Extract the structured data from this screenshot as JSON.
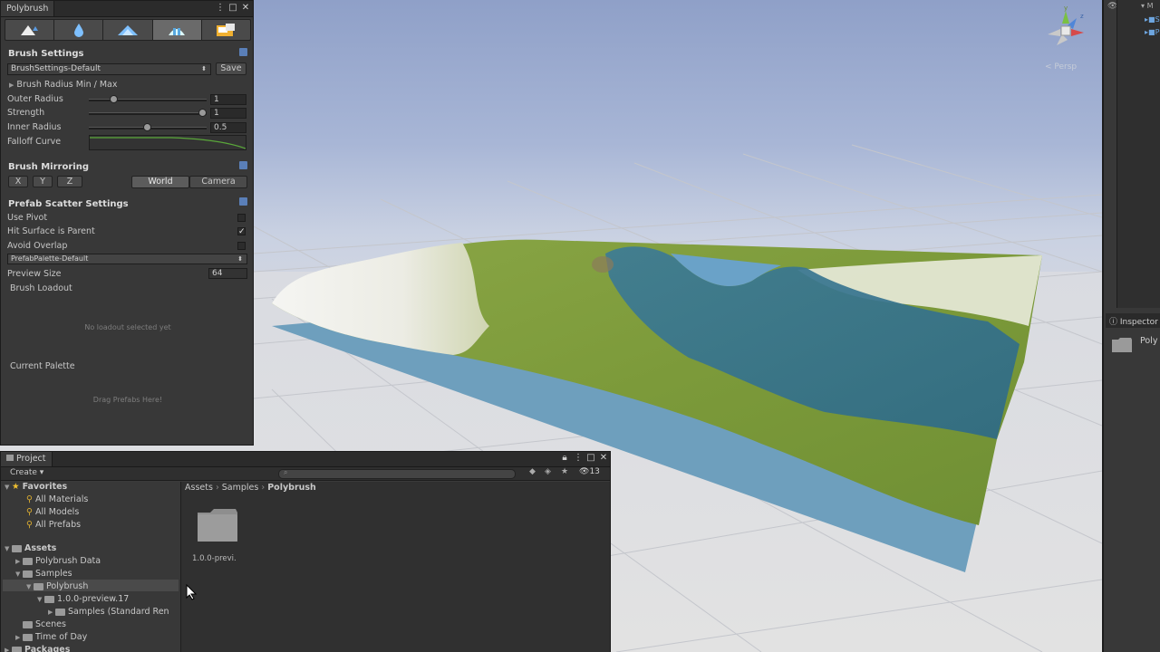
{
  "polybrush": {
    "title": "Polybrush",
    "modes": [
      "raise-lower-icon",
      "smooth-icon",
      "sculpt-icon",
      "scatter-prefab-icon",
      "texture-paint-icon"
    ],
    "brush_settings": {
      "header": "Brush Settings",
      "preset": "BrushSettings-Default",
      "save_label": "Save",
      "radius_foldout": "Brush Radius Min / Max",
      "outer_radius": {
        "label": "Outer Radius",
        "value": "1",
        "level": 0.2
      },
      "strength": {
        "label": "Strength",
        "value": "1",
        "level": 1.0
      },
      "inner_radius": {
        "label": "Inner Radius",
        "value": "0.5",
        "level": 0.5
      },
      "falloff_label": "Falloff Curve"
    },
    "mirroring": {
      "header": "Brush Mirroring",
      "axes": [
        "X",
        "Y",
        "Z"
      ],
      "space_world": "World",
      "space_camera": "Camera"
    },
    "scatter": {
      "header": "Prefab Scatter Settings",
      "use_pivot": {
        "label": "Use Pivot",
        "checked": false
      },
      "hit_surface": {
        "label": "Hit Surface is Parent",
        "checked": true
      },
      "avoid_overlap": {
        "label": "Avoid Overlap",
        "checked": false
      },
      "palette": "PrefabPalette-Default",
      "preview_size_label": "Preview Size",
      "preview_size_value": "64",
      "loadout_label": "Brush Loadout",
      "loadout_empty": "No loadout selected yet",
      "current_palette_label": "Current Palette",
      "drag_hint": "Drag Prefabs Here!"
    }
  },
  "project": {
    "tab": "Project",
    "create_label": "Create",
    "count": "13",
    "breadcrumb": [
      "Assets",
      "Samples",
      "Polybrush"
    ],
    "favorites": {
      "header": "Favorites",
      "items": [
        "All Materials",
        "All Models",
        "All Prefabs"
      ]
    },
    "assets_header": "Assets",
    "tree": {
      "polybrush_data": "Polybrush Data",
      "samples": "Samples",
      "polybrush": "Polybrush",
      "preview": "1.0.0-preview.17",
      "samples_standard": "Samples (Standard Ren",
      "scenes": "Scenes",
      "time_of_day": "Time of Day"
    },
    "packages_header": "Packages",
    "grid_item": "1.0.0-previ."
  },
  "scene": {
    "persp_label": "< Persp",
    "gizmo": {
      "y": "y",
      "z": "z"
    }
  },
  "inspector": {
    "tab": "Inspector",
    "item": "Poly"
  },
  "hierarchy": {
    "rows": [
      "M",
      "S",
      "P"
    ]
  },
  "colors": {
    "accent_blue": "#5a7fb8",
    "water": "#4f86a8",
    "grass": "#7d9a3c",
    "snow": "#f2f2ee"
  }
}
